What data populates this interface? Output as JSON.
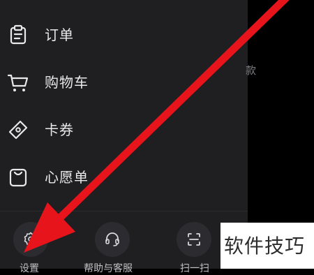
{
  "menu": {
    "items": [
      {
        "label": "订单",
        "icon": "clipboard-icon"
      },
      {
        "label": "购物车",
        "icon": "cart-icon"
      },
      {
        "label": "卡券",
        "icon": "ticket-icon"
      },
      {
        "label": "心愿单",
        "icon": "bag-icon"
      }
    ]
  },
  "bottom": {
    "settings_label": "设置",
    "help_label": "帮助与客服",
    "scan_label": "扫一扫"
  },
  "background": {
    "peek_text": "款"
  },
  "watermark": {
    "text": "软件技巧"
  },
  "colors": {
    "drawer_bg": "#1f1f22",
    "arrow": "#e8141b",
    "text": "#e9e9ec"
  }
}
